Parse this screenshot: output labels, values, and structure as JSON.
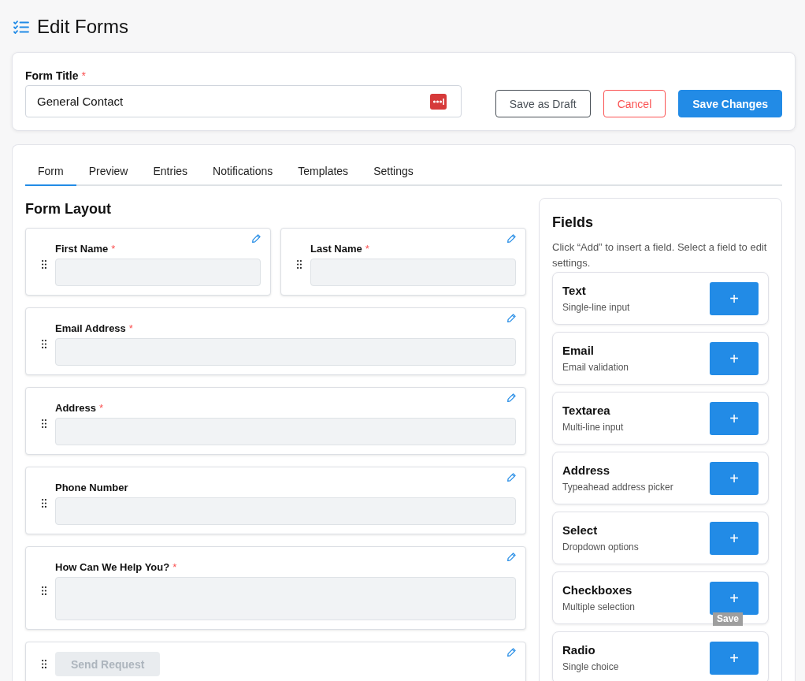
{
  "page": {
    "title": "Edit Forms"
  },
  "required_mark": "*",
  "form_title": {
    "label": "Form Title",
    "required": true,
    "value": "General Contact"
  },
  "actions": [
    {
      "label": "Save as Draft",
      "kind": "outline"
    },
    {
      "label": "Cancel",
      "kind": "danger"
    },
    {
      "label": "Save Changes",
      "kind": "primary"
    }
  ],
  "tabs": [
    {
      "label": "Form",
      "selected": true
    },
    {
      "label": "Preview",
      "selected": false
    },
    {
      "label": "Entries",
      "selected": false
    },
    {
      "label": "Notifications",
      "selected": false
    },
    {
      "label": "Templates",
      "selected": false
    },
    {
      "label": "Settings",
      "selected": false
    }
  ],
  "form_layout": {
    "title": "Form Layout",
    "rows": [
      [
        {
          "kind": "input",
          "label": "First Name",
          "required": true
        },
        {
          "kind": "input",
          "label": "Last Name",
          "required": true
        }
      ],
      [
        {
          "kind": "input",
          "label": "Email Address",
          "required": true
        }
      ],
      [
        {
          "kind": "input",
          "label": "Address",
          "required": true
        }
      ],
      [
        {
          "kind": "input",
          "label": "Phone Number",
          "required": false
        }
      ],
      [
        {
          "kind": "textarea",
          "label": "How Can We Help You?",
          "required": true
        }
      ],
      [
        {
          "kind": "button",
          "label": "Send Request",
          "disabled": true
        }
      ]
    ]
  },
  "fields_panel": {
    "title": "Fields",
    "description": "Click “Add” to insert a field. Select a field to edit settings.",
    "items": [
      {
        "name": "Text",
        "hint": "Single-line input",
        "add": "+"
      },
      {
        "name": "Email",
        "hint": "Email validation",
        "add": "+"
      },
      {
        "name": "Textarea",
        "hint": "Multi-line input",
        "add": "+"
      },
      {
        "name": "Address",
        "hint": "Typeahead address picker",
        "add": "+"
      },
      {
        "name": "Select",
        "hint": "Dropdown options",
        "add": "+"
      },
      {
        "name": "Checkboxes",
        "hint": "Multiple selection",
        "add": "+",
        "tooltip": "Save"
      },
      {
        "name": "Radio",
        "hint": "Single choice",
        "add": "+"
      }
    ]
  }
}
